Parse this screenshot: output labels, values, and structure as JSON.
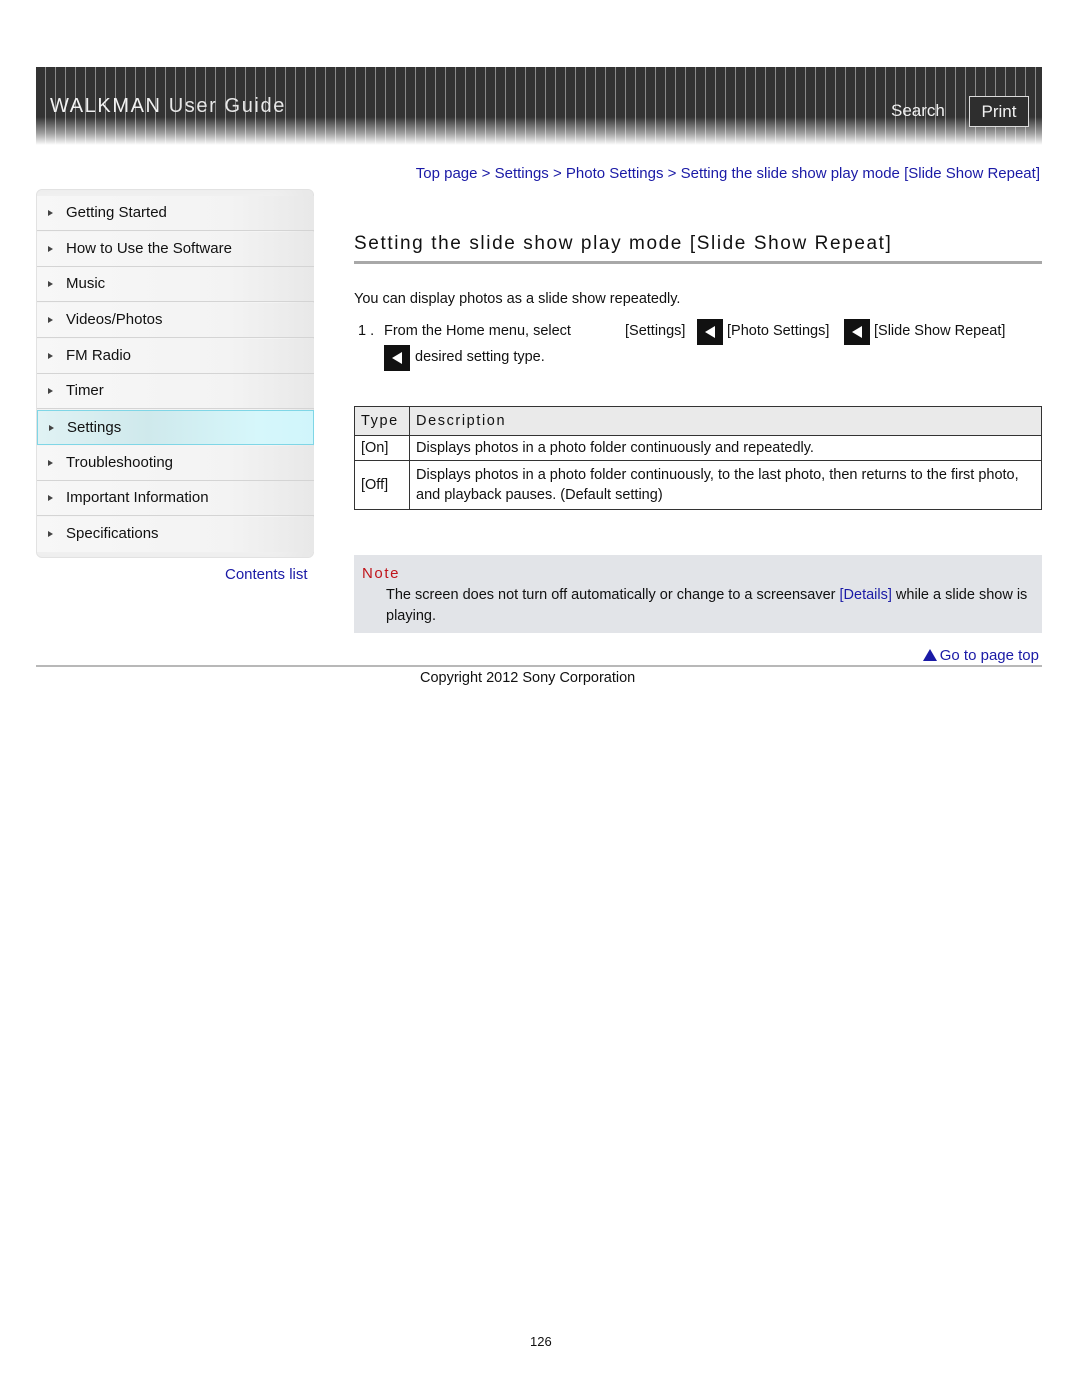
{
  "header": {
    "title_bold": "WALKMAN",
    "title_light": "User Guide",
    "search_label": "Search",
    "print_label": "Print"
  },
  "sidebar": {
    "items": [
      {
        "label": "Getting Started"
      },
      {
        "label": "How to Use the Software"
      },
      {
        "label": "Music"
      },
      {
        "label": "Videos/Photos"
      },
      {
        "label": "FM Radio"
      },
      {
        "label": "Timer"
      },
      {
        "label": "Settings",
        "active": true
      },
      {
        "label": "Troubleshooting"
      },
      {
        "label": "Important Information"
      },
      {
        "label": "Specifications"
      }
    ],
    "contents_link": "Contents list"
  },
  "breadcrumb": {
    "items": [
      "Top page",
      "Settings",
      "Photo Settings",
      "Setting the slide show play mode [Slide Show Repeat]"
    ],
    "separator": ">"
  },
  "main": {
    "title": "Setting the slide show play mode [Slide Show Repeat]",
    "intro": "You can display photos as a slide show repeatedly.",
    "step": {
      "number": "1 .",
      "text_start": "From the Home menu, select",
      "seg1": "[Settings]",
      "seg2": "[Photo Settings]",
      "seg3": "[Slide Show Repeat]",
      "seg4": "desired setting type."
    },
    "table": {
      "headers": [
        "Type",
        "Description"
      ],
      "rows": [
        {
          "type": "[On]",
          "description": "Displays photos in a photo folder continuously and repeatedly."
        },
        {
          "type": "[Off]",
          "description": "Displays photos in a photo folder continuously, to the last photo, then returns to the first photo, and playback pauses. (Default setting)"
        }
      ]
    },
    "note": {
      "title": "Note",
      "text_before": "The screen does not turn off automatically or change to a screensaver ",
      "link": "[Details]",
      "text_after": " while a slide show is playing."
    }
  },
  "footer": {
    "go_top": "Go to page top",
    "copyright": "Copyright 2012 Sony Corporation",
    "page_number": "126"
  },
  "colors": {
    "link": "#1a1aa6",
    "note_title": "#c0141a",
    "note_bg": "#e2e4e8",
    "active_nav": "#d0f5fb"
  }
}
